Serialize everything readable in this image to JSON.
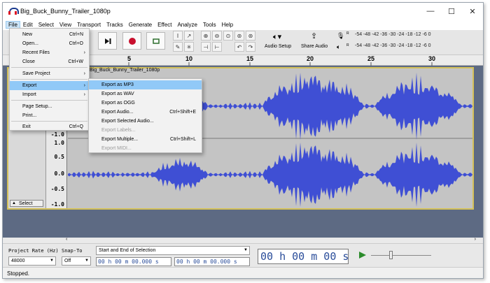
{
  "window": {
    "title": "Big_Buck_Bunny_Trailer_1080p",
    "controls": [
      "—",
      "☐",
      "✕"
    ]
  },
  "menubar": [
    "File",
    "Edit",
    "Select",
    "View",
    "Transport",
    "Tracks",
    "Generate",
    "Effect",
    "Analyze",
    "Tools",
    "Help"
  ],
  "toolbar": {
    "audio_setup": "Audio Setup",
    "share_audio": "Share Audio",
    "meter_scale": "-54 -48 -42 -36 -30 -24 -18 -12 -6 0",
    "meter_channel_r": "R",
    "meter_channel_l": "L"
  },
  "ruler": {
    "labels": [
      "5",
      "10",
      "15",
      "20",
      "25",
      "30"
    ]
  },
  "track": {
    "name": "Big_Buck_Bunny_Trailer_1080p",
    "select_label": "Select",
    "y_labels_top": [
      "-1.0"
    ],
    "y_labels_bottom": [
      "1.0",
      "0.5",
      "0.0",
      "-0.5",
      "-1.0"
    ],
    "wave_color": "#3f4fd4"
  },
  "file_menu": {
    "items": [
      {
        "label": "New",
        "shortcut": "Ctrl+N"
      },
      {
        "label": "Open...",
        "shortcut": "Ctrl+O"
      },
      {
        "label": "Recent Files",
        "shortcut": "›"
      },
      {
        "label": "Close",
        "shortcut": "Ctrl+W"
      },
      {
        "label": "Save Project",
        "shortcut": "›"
      },
      {
        "label": "Export",
        "shortcut": "›"
      },
      {
        "label": "Import",
        "shortcut": "›"
      },
      {
        "label": "Page Setup...",
        "shortcut": ""
      },
      {
        "label": "Print...",
        "shortcut": ""
      },
      {
        "label": "Exit",
        "shortcut": "Ctrl+Q"
      }
    ]
  },
  "export_menu": {
    "items": [
      {
        "label": "Export as MP3",
        "shortcut": ""
      },
      {
        "label": "Export as WAV",
        "shortcut": ""
      },
      {
        "label": "Export as OGG",
        "shortcut": ""
      },
      {
        "label": "Export Audio...",
        "shortcut": "Ctrl+Shift+E"
      },
      {
        "label": "Export Selected Audio...",
        "shortcut": ""
      },
      {
        "label": "Export Labels...",
        "shortcut": ""
      },
      {
        "label": "Export Multiple...",
        "shortcut": "Ctrl+Shift+L"
      },
      {
        "label": "Export MIDI...",
        "shortcut": ""
      }
    ]
  },
  "selection_bar": {
    "project_rate_label": "Project Rate (Hz)",
    "project_rate_value": "48000",
    "snap_to_label": "Snap-To",
    "snap_to_value": "Off",
    "selection_mode": "Start and End of Selection",
    "start_time": "00 h 00 m 00.000 s",
    "end_time": "00 h 00 m 00.000 s",
    "big_time": "00 h 00 m 00 s"
  },
  "status": {
    "text": "Stopped."
  }
}
